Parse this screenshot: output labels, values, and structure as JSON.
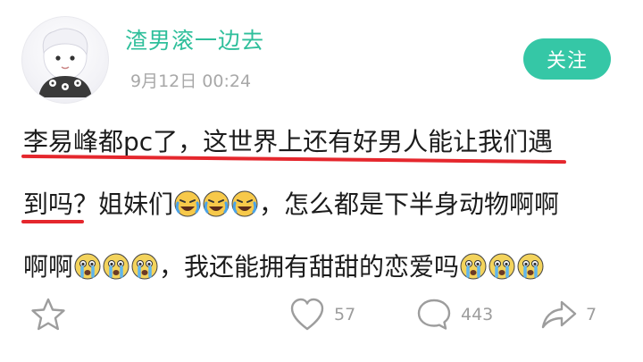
{
  "header": {
    "username": "渣男滚一边去",
    "timestamp": "9月12日 00:24",
    "follow_label": "关注"
  },
  "post": {
    "line1": "李易峰都pc了，这世界上还有好男人能让我们遇",
    "line2_a": "到吗？姐妹们",
    "line2_b": "，怎么都是下半身动物啊啊",
    "line3_a": "啊啊",
    "line3_b": "，我还能拥有甜甜的恋爱吗"
  },
  "actions": {
    "likes": "57",
    "comments": "443",
    "shares": "7"
  },
  "colors": {
    "accent": "#35c7a6",
    "username": "#2fbf9b",
    "underline": "#e5272d",
    "meta": "#a8a8a8"
  },
  "icons": {
    "emoji_line2": "crying-laughing-emoji",
    "emoji_line3": "crying-emoji",
    "star": "star-icon",
    "like": "heart-icon",
    "comment": "comment-bubble-icon",
    "share": "share-arrow-icon"
  }
}
